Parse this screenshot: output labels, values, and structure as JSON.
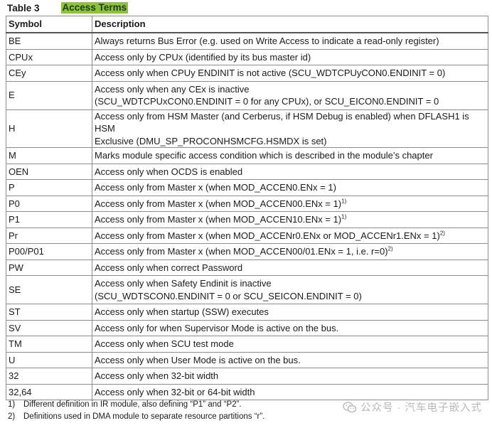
{
  "caption": {
    "label": "Table 3",
    "title": "Access Terms"
  },
  "header": {
    "symbol": "Symbol",
    "description": "Description"
  },
  "rows": [
    {
      "symbol": "BE",
      "desc": "Always returns Bus Error (e.g. used on Write Access to indicate a read-only register)"
    },
    {
      "symbol": "CPUx",
      "desc": "Access only by CPUx (identified by its bus master id)"
    },
    {
      "symbol": "CEy",
      "desc": "Access only when CPUy ENDINIT is not active (SCU_WDTCPUyCON0.ENDINIT = 0)"
    },
    {
      "symbol": "E",
      "desc": "Access only when any CEx is inactive\n(SCU_WDTCPUxCON0.ENDINIT = 0 for any CPUx), or SCU_EICON0.ENDINIT = 0"
    },
    {
      "symbol": "H",
      "desc": "Access only from HSM Master (and Cerberus, if HSM Debug is enabled) when DFLASH1 is HSM\nExclusive (DMU_SP_PROCONHSMCFG.HSMDX is set)"
    },
    {
      "symbol": "M",
      "desc": "Marks module specific access condition which is described in the module’s chapter"
    },
    {
      "symbol": "OEN",
      "desc": "Access only when OCDS is enabled"
    },
    {
      "symbol": "P",
      "desc": "Access only from Master x (when MOD_ACCEN0.ENx = 1)"
    },
    {
      "symbol": "P0",
      "desc": "Access only from Master x (when MOD_ACCEN00.ENx = 1)",
      "fn": "1)"
    },
    {
      "symbol": "P1",
      "desc": "Access only from Master x (when MOD_ACCEN10.ENx = 1)",
      "fn": "1)"
    },
    {
      "symbol": "Pr",
      "desc": "Access only from Master x (when MOD_ACCENr0.ENx or MOD_ACCENr1.ENx = 1)",
      "fn": "2)"
    },
    {
      "symbol": "P00/P01",
      "desc": "Access only from Master x (when MOD_ACCEN00/01.ENx = 1, i.e. r=0)",
      "fn": "2)"
    },
    {
      "symbol": "PW",
      "desc": "Access only when correct Password"
    },
    {
      "symbol": "SE",
      "desc": "Access only when Safety Endinit is inactive\n(SCU_WDTSCON0.ENDINIT = 0 or SCU_SEICON.ENDINIT = 0)"
    },
    {
      "symbol": "ST",
      "desc": "Access only when startup (SSW) executes"
    },
    {
      "symbol": "SV",
      "desc": "Access only for when Supervisor Mode is active on the bus."
    },
    {
      "symbol": "TM",
      "desc": "Access only when SCU test mode"
    },
    {
      "symbol": "U",
      "desc": "Access only when User Mode is active on the bus."
    },
    {
      "symbol": "32",
      "desc": "Access only when 32-bit width"
    },
    {
      "symbol": "32,64",
      "desc": "Access only when 32-bit or 64-bit width"
    }
  ],
  "footnotes": [
    {
      "num": "1)",
      "text": "Different definition in IR module, also defining “P1” and “P2”."
    },
    {
      "num": "2)",
      "text": "Definitions used in DMA module to separate resource partitions “r”."
    }
  ],
  "watermark": {
    "text": "公众号 · 汽车电子嵌入式",
    "icon": "wechat-icon"
  }
}
